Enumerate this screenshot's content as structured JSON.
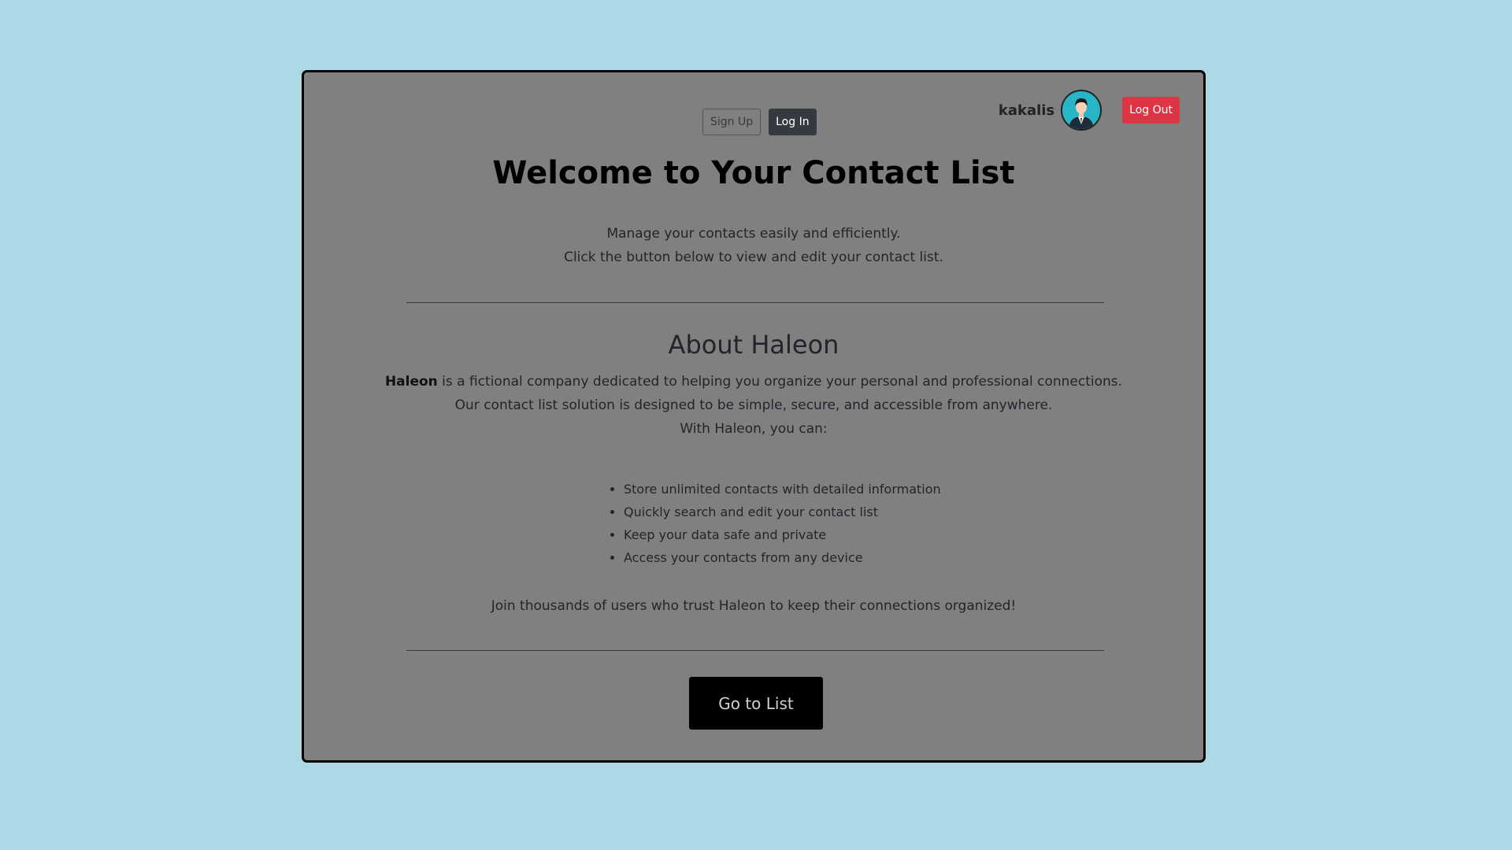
{
  "auth": {
    "signup_label": "Sign Up",
    "login_label": "Log In"
  },
  "user": {
    "name": "kakalis",
    "avatar_icon": "user-avatar-icon",
    "logout_label": "Log Out"
  },
  "hero": {
    "title": "Welcome to Your Contact List",
    "line1": "Manage your contacts easily and efficiently.",
    "line2": "Click the button below to view and edit your contact list."
  },
  "about": {
    "title": "About Haleon",
    "brand": "Haleon",
    "line1_rest": " is a fictional company dedicated to helping you organize your personal and professional connections.",
    "line2": "Our contact list solution is designed to be simple, secure, and accessible from anywhere.",
    "line3": "With Haleon, you can:",
    "features": [
      "Store unlimited contacts with detailed information",
      "Quickly search and edit your contact list",
      "Keep your data safe and private",
      "Access your contacts from any device"
    ],
    "closing": "Join thousands of users who trust Haleon to keep their connections organized!"
  },
  "cta": {
    "label": "Go to List"
  },
  "colors": {
    "page_background": "#add8e6",
    "card_background": "#808080",
    "logout": "#dc3545",
    "login": "#343a40",
    "cta": "#000000"
  }
}
